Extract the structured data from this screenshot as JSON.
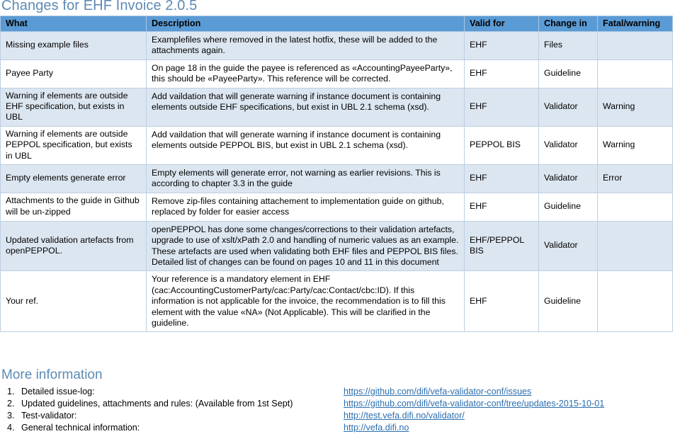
{
  "document": {
    "title": "Changes for EHF Invoice 2.0.5"
  },
  "table": {
    "headers": {
      "what": "What",
      "description": "Description",
      "valid_for": "Valid for",
      "change_in": "Change in",
      "fatal_warning": "Fatal/warning"
    },
    "rows": [
      {
        "what": "Missing example files",
        "description": "Examplefiles where removed in the latest hotfix, these will be added to the attachments again.",
        "valid_for": "EHF",
        "change_in": "Files",
        "fatal_warning": ""
      },
      {
        "what": "Payee Party",
        "description": "On page 18 in the guide the payee is referenced as «AccountingPayeeParty», this should be «PayeeParty».  This reference will be corrected.",
        "valid_for": "EHF",
        "change_in": "Guideline",
        "fatal_warning": ""
      },
      {
        "what": "Warning if elements are outside EHF specification, but exists in UBL",
        "description": "Add vaildation that will generate warning if instance document is containing elements outside EHF specifications, but exist in UBL 2.1 schema (xsd).",
        "valid_for": "EHF",
        "change_in": "Validator",
        "fatal_warning": "Warning"
      },
      {
        "what": "Warning if elements are outside PEPPOL specification, but exists in UBL",
        "description": "Add vaildation that will generate warning if instance document is containing elements outside PEPPOL BIS, but exist in UBL 2.1 schema (xsd).",
        "valid_for": "PEPPOL BIS",
        "change_in": "Validator",
        "fatal_warning": "Warning"
      },
      {
        "what": "Empty elements generate error",
        "description": "Empty elements will generate error, not warning as earlier revisions. This is according to chapter 3.3 in the guide",
        "valid_for": "EHF",
        "change_in": "Validator",
        "fatal_warning": "Error"
      },
      {
        "what": "Attachments to the guide in Github will be un-zipped",
        "description": "Remove zip-files containing attachement to implementation guide on github, replaced by folder for easier access",
        "valid_for": "EHF",
        "change_in": "Guideline",
        "fatal_warning": ""
      },
      {
        "what": "Updated validation artefacts from openPEPPOL.",
        "description": "openPEPPOL has done some changes/corrections to their validation artefacts, upgrade to use of xslt/xPath 2.0 and handling of numeric values as an example. These artefacts are used when validating both EHF files and PEPPOL BIS files.\nDetailed list of changes can be found on pages 10 and 11 in this document",
        "valid_for": "EHF/PEPPOL BIS",
        "change_in": "Validator",
        "fatal_warning": ""
      },
      {
        "what": "Your ref.",
        "description": "Your reference is a mandatory element in EHF (cac:AccountingCustomerParty/cac:Party/cac:Contact/cbc:ID). If this information is not applicable for the invoice, the recommendation is to fill this element with the value «NA» (Not Applicable). This will be clarified in the guideline.",
        "valid_for": "EHF",
        "change_in": "Guideline",
        "fatal_warning": ""
      }
    ]
  },
  "more_information": {
    "heading": "More information",
    "items": [
      {
        "number": "1.",
        "label": "Detailed issue-log:",
        "link": "https://github.com/difi/vefa-validator-conf/issues"
      },
      {
        "number": "2.",
        "label": "Updated guidelines, attachments and rules: (Available from 1st Sept)",
        "link": "https://github.com/difi/vefa-validator-conf/tree/updates-2015-10-01"
      },
      {
        "number": "3.",
        "label": "Test-validator:",
        "link": "http://test.vefa.difi.no/validator/"
      },
      {
        "number": "4.",
        "label": "General technical information:",
        "link": "http://vefa.difi.no"
      }
    ]
  },
  "colors": {
    "title_blue": "#5E8AB4",
    "header_blue": "#5B9BD5",
    "row_shaded": "#DCE6F1",
    "link_blue": "#2C6FAF",
    "border": "#BCCFE3"
  }
}
